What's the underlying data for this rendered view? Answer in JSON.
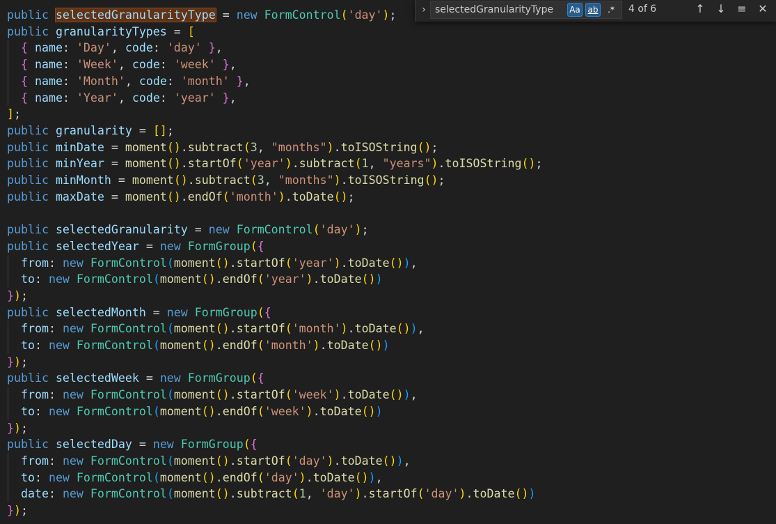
{
  "find": {
    "query": "selectedGranularityType",
    "match_case_label": "Aa",
    "whole_word_label": "ab",
    "regex_label": ".*",
    "match_count": "4 of 6",
    "toggle_replace_icon": "›",
    "prev_icon": "↑",
    "next_icon": "↓",
    "selection_icon": "≡",
    "close_icon": "✕"
  },
  "code_lines": [
    [
      [
        "kw",
        "public "
      ],
      [
        "var",
        "selectedGranularityType",
        "hl"
      ],
      [
        "op",
        " = "
      ],
      [
        "kw",
        "new "
      ],
      [
        "cls",
        "FormControl"
      ],
      [
        "b1",
        "("
      ],
      [
        "str",
        "'day'"
      ],
      [
        "b1",
        ")"
      ],
      [
        "op",
        ";"
      ]
    ],
    [
      [
        "kw",
        "public "
      ],
      [
        "var",
        "granularityTypes"
      ],
      [
        "op",
        " = "
      ],
      [
        "b1",
        "["
      ]
    ],
    [
      [
        "op",
        "  "
      ],
      [
        "b2",
        "{ "
      ],
      [
        "var",
        "name"
      ],
      [
        "op",
        ": "
      ],
      [
        "str",
        "'Day'"
      ],
      [
        "op",
        ", "
      ],
      [
        "var",
        "code"
      ],
      [
        "op",
        ": "
      ],
      [
        "str",
        "'day'"
      ],
      [
        "b2",
        " }"
      ],
      [
        "op",
        ","
      ]
    ],
    [
      [
        "op",
        "  "
      ],
      [
        "b2",
        "{ "
      ],
      [
        "var",
        "name"
      ],
      [
        "op",
        ": "
      ],
      [
        "str",
        "'Week'"
      ],
      [
        "op",
        ", "
      ],
      [
        "var",
        "code"
      ],
      [
        "op",
        ": "
      ],
      [
        "str",
        "'week'"
      ],
      [
        "b2",
        " }"
      ],
      [
        "op",
        ","
      ]
    ],
    [
      [
        "op",
        "  "
      ],
      [
        "b2",
        "{ "
      ],
      [
        "var",
        "name"
      ],
      [
        "op",
        ": "
      ],
      [
        "str",
        "'Month'"
      ],
      [
        "op",
        ", "
      ],
      [
        "var",
        "code"
      ],
      [
        "op",
        ": "
      ],
      [
        "str",
        "'month'"
      ],
      [
        "b2",
        " }"
      ],
      [
        "op",
        ","
      ]
    ],
    [
      [
        "op",
        "  "
      ],
      [
        "b2",
        "{ "
      ],
      [
        "var",
        "name"
      ],
      [
        "op",
        ": "
      ],
      [
        "str",
        "'Year'"
      ],
      [
        "op",
        ", "
      ],
      [
        "var",
        "code"
      ],
      [
        "op",
        ": "
      ],
      [
        "str",
        "'year'"
      ],
      [
        "b2",
        " }"
      ],
      [
        "op",
        ","
      ]
    ],
    [
      [
        "b1",
        "]"
      ],
      [
        "op",
        ";"
      ]
    ],
    [
      [
        "kw",
        "public "
      ],
      [
        "var",
        "granularity"
      ],
      [
        "op",
        " = "
      ],
      [
        "b1",
        "[]"
      ],
      [
        "op",
        ";"
      ]
    ],
    [
      [
        "kw",
        "public "
      ],
      [
        "var",
        "minDate"
      ],
      [
        "op",
        " = "
      ],
      [
        "fn",
        "moment"
      ],
      [
        "b1",
        "()"
      ],
      [
        "op",
        "."
      ],
      [
        "fn",
        "subtract"
      ],
      [
        "b1",
        "("
      ],
      [
        "num",
        "3"
      ],
      [
        "op",
        ", "
      ],
      [
        "str",
        "\"months\""
      ],
      [
        "b1",
        ")"
      ],
      [
        "op",
        "."
      ],
      [
        "fn",
        "toISOString"
      ],
      [
        "b1",
        "()"
      ],
      [
        "op",
        ";"
      ]
    ],
    [
      [
        "kw",
        "public "
      ],
      [
        "var",
        "minYear"
      ],
      [
        "op",
        " = "
      ],
      [
        "fn",
        "moment"
      ],
      [
        "b1",
        "()"
      ],
      [
        "op",
        "."
      ],
      [
        "fn",
        "startOf"
      ],
      [
        "b1",
        "("
      ],
      [
        "str",
        "'year'"
      ],
      [
        "b1",
        ")"
      ],
      [
        "op",
        "."
      ],
      [
        "fn",
        "subtract"
      ],
      [
        "b1",
        "("
      ],
      [
        "num",
        "1"
      ],
      [
        "op",
        ", "
      ],
      [
        "str",
        "\"years\""
      ],
      [
        "b1",
        ")"
      ],
      [
        "op",
        "."
      ],
      [
        "fn",
        "toISOString"
      ],
      [
        "b1",
        "()"
      ],
      [
        "op",
        ";"
      ]
    ],
    [
      [
        "kw",
        "public "
      ],
      [
        "var",
        "minMonth"
      ],
      [
        "op",
        " = "
      ],
      [
        "fn",
        "moment"
      ],
      [
        "b1",
        "()"
      ],
      [
        "op",
        "."
      ],
      [
        "fn",
        "subtract"
      ],
      [
        "b1",
        "("
      ],
      [
        "num",
        "3"
      ],
      [
        "op",
        ", "
      ],
      [
        "str",
        "\"months\""
      ],
      [
        "b1",
        ")"
      ],
      [
        "op",
        "."
      ],
      [
        "fn",
        "toISOString"
      ],
      [
        "b1",
        "()"
      ],
      [
        "op",
        ";"
      ]
    ],
    [
      [
        "kw",
        "public "
      ],
      [
        "var",
        "maxDate"
      ],
      [
        "op",
        " = "
      ],
      [
        "fn",
        "moment"
      ],
      [
        "b1",
        "()"
      ],
      [
        "op",
        "."
      ],
      [
        "fn",
        "endOf"
      ],
      [
        "b1",
        "("
      ],
      [
        "str",
        "'month'"
      ],
      [
        "b1",
        ")"
      ],
      [
        "op",
        "."
      ],
      [
        "fn",
        "toDate"
      ],
      [
        "b1",
        "()"
      ],
      [
        "op",
        ";"
      ]
    ],
    [],
    [
      [
        "kw",
        "public "
      ],
      [
        "var",
        "selectedGranularity"
      ],
      [
        "op",
        " = "
      ],
      [
        "kw",
        "new "
      ],
      [
        "cls",
        "FormControl"
      ],
      [
        "b1",
        "("
      ],
      [
        "str",
        "'day'"
      ],
      [
        "b1",
        ")"
      ],
      [
        "op",
        ";"
      ]
    ],
    [
      [
        "kw",
        "public "
      ],
      [
        "var",
        "selectedYear"
      ],
      [
        "op",
        " = "
      ],
      [
        "kw",
        "new "
      ],
      [
        "cls",
        "FormGroup"
      ],
      [
        "b1",
        "("
      ],
      [
        "b2",
        "{"
      ]
    ],
    [
      [
        "op",
        "  "
      ],
      [
        "var",
        "from"
      ],
      [
        "op",
        ": "
      ],
      [
        "kw",
        "new "
      ],
      [
        "cls",
        "FormControl"
      ],
      [
        "b3",
        "("
      ],
      [
        "fn",
        "moment"
      ],
      [
        "b1",
        "()"
      ],
      [
        "op",
        "."
      ],
      [
        "fn",
        "startOf"
      ],
      [
        "b1",
        "("
      ],
      [
        "str",
        "'year'"
      ],
      [
        "b1",
        ")"
      ],
      [
        "op",
        "."
      ],
      [
        "fn",
        "toDate"
      ],
      [
        "b1",
        "()"
      ],
      [
        "b3",
        ")"
      ],
      [
        "op",
        ","
      ]
    ],
    [
      [
        "op",
        "  "
      ],
      [
        "var",
        "to"
      ],
      [
        "op",
        ": "
      ],
      [
        "kw",
        "new "
      ],
      [
        "cls",
        "FormControl"
      ],
      [
        "b3",
        "("
      ],
      [
        "fn",
        "moment"
      ],
      [
        "b1",
        "()"
      ],
      [
        "op",
        "."
      ],
      [
        "fn",
        "endOf"
      ],
      [
        "b1",
        "("
      ],
      [
        "str",
        "'year'"
      ],
      [
        "b1",
        ")"
      ],
      [
        "op",
        "."
      ],
      [
        "fn",
        "toDate"
      ],
      [
        "b1",
        "()"
      ],
      [
        "b3",
        ")"
      ]
    ],
    [
      [
        "b2",
        "}"
      ],
      [
        "b1",
        ")"
      ],
      [
        "op",
        ";"
      ]
    ],
    [
      [
        "kw",
        "public "
      ],
      [
        "var",
        "selectedMonth"
      ],
      [
        "op",
        " = "
      ],
      [
        "kw",
        "new "
      ],
      [
        "cls",
        "FormGroup"
      ],
      [
        "b1",
        "("
      ],
      [
        "b2",
        "{"
      ]
    ],
    [
      [
        "op",
        "  "
      ],
      [
        "var",
        "from"
      ],
      [
        "op",
        ": "
      ],
      [
        "kw",
        "new "
      ],
      [
        "cls",
        "FormControl"
      ],
      [
        "b3",
        "("
      ],
      [
        "fn",
        "moment"
      ],
      [
        "b1",
        "()"
      ],
      [
        "op",
        "."
      ],
      [
        "fn",
        "startOf"
      ],
      [
        "b1",
        "("
      ],
      [
        "str",
        "'month'"
      ],
      [
        "b1",
        ")"
      ],
      [
        "op",
        "."
      ],
      [
        "fn",
        "toDate"
      ],
      [
        "b1",
        "()"
      ],
      [
        "b3",
        ")"
      ],
      [
        "op",
        ","
      ]
    ],
    [
      [
        "op",
        "  "
      ],
      [
        "var",
        "to"
      ],
      [
        "op",
        ": "
      ],
      [
        "kw",
        "new "
      ],
      [
        "cls",
        "FormControl"
      ],
      [
        "b3",
        "("
      ],
      [
        "fn",
        "moment"
      ],
      [
        "b1",
        "()"
      ],
      [
        "op",
        "."
      ],
      [
        "fn",
        "endOf"
      ],
      [
        "b1",
        "("
      ],
      [
        "str",
        "'month'"
      ],
      [
        "b1",
        ")"
      ],
      [
        "op",
        "."
      ],
      [
        "fn",
        "toDate"
      ],
      [
        "b1",
        "()"
      ],
      [
        "b3",
        ")"
      ]
    ],
    [
      [
        "b2",
        "}"
      ],
      [
        "b1",
        ")"
      ],
      [
        "op",
        ";"
      ]
    ],
    [
      [
        "kw",
        "public "
      ],
      [
        "var",
        "selectedWeek"
      ],
      [
        "op",
        " = "
      ],
      [
        "kw",
        "new "
      ],
      [
        "cls",
        "FormGroup"
      ],
      [
        "b1",
        "("
      ],
      [
        "b2",
        "{"
      ]
    ],
    [
      [
        "op",
        "  "
      ],
      [
        "var",
        "from"
      ],
      [
        "op",
        ": "
      ],
      [
        "kw",
        "new "
      ],
      [
        "cls",
        "FormControl"
      ],
      [
        "b3",
        "("
      ],
      [
        "fn",
        "moment"
      ],
      [
        "b1",
        "()"
      ],
      [
        "op",
        "."
      ],
      [
        "fn",
        "startOf"
      ],
      [
        "b1",
        "("
      ],
      [
        "str",
        "'week'"
      ],
      [
        "b1",
        ")"
      ],
      [
        "op",
        "."
      ],
      [
        "fn",
        "toDate"
      ],
      [
        "b1",
        "()"
      ],
      [
        "b3",
        ")"
      ],
      [
        "op",
        ","
      ]
    ],
    [
      [
        "op",
        "  "
      ],
      [
        "var",
        "to"
      ],
      [
        "op",
        ": "
      ],
      [
        "kw",
        "new "
      ],
      [
        "cls",
        "FormControl"
      ],
      [
        "b3",
        "("
      ],
      [
        "fn",
        "moment"
      ],
      [
        "b1",
        "()"
      ],
      [
        "op",
        "."
      ],
      [
        "fn",
        "endOf"
      ],
      [
        "b1",
        "("
      ],
      [
        "str",
        "'week'"
      ],
      [
        "b1",
        ")"
      ],
      [
        "op",
        "."
      ],
      [
        "fn",
        "toDate"
      ],
      [
        "b1",
        "()"
      ],
      [
        "b3",
        ")"
      ]
    ],
    [
      [
        "b2",
        "}"
      ],
      [
        "b1",
        ")"
      ],
      [
        "op",
        ";"
      ]
    ],
    [
      [
        "kw",
        "public "
      ],
      [
        "var",
        "selectedDay"
      ],
      [
        "op",
        " = "
      ],
      [
        "kw",
        "new "
      ],
      [
        "cls",
        "FormGroup"
      ],
      [
        "b1",
        "("
      ],
      [
        "b2",
        "{"
      ]
    ],
    [
      [
        "op",
        "  "
      ],
      [
        "var",
        "from"
      ],
      [
        "op",
        ": "
      ],
      [
        "kw",
        "new "
      ],
      [
        "cls",
        "FormControl"
      ],
      [
        "b3",
        "("
      ],
      [
        "fn",
        "moment"
      ],
      [
        "b1",
        "()"
      ],
      [
        "op",
        "."
      ],
      [
        "fn",
        "startOf"
      ],
      [
        "b1",
        "("
      ],
      [
        "str",
        "'day'"
      ],
      [
        "b1",
        ")"
      ],
      [
        "op",
        "."
      ],
      [
        "fn",
        "toDate"
      ],
      [
        "b1",
        "()"
      ],
      [
        "b3",
        ")"
      ],
      [
        "op",
        ","
      ]
    ],
    [
      [
        "op",
        "  "
      ],
      [
        "var",
        "to"
      ],
      [
        "op",
        ": "
      ],
      [
        "kw",
        "new "
      ],
      [
        "cls",
        "FormControl"
      ],
      [
        "b3",
        "("
      ],
      [
        "fn",
        "moment"
      ],
      [
        "b1",
        "()"
      ],
      [
        "op",
        "."
      ],
      [
        "fn",
        "endOf"
      ],
      [
        "b1",
        "("
      ],
      [
        "str",
        "'day'"
      ],
      [
        "b1",
        ")"
      ],
      [
        "op",
        "."
      ],
      [
        "fn",
        "toDate"
      ],
      [
        "b1",
        "()"
      ],
      [
        "b3",
        ")"
      ],
      [
        "op",
        ","
      ]
    ],
    [
      [
        "op",
        "  "
      ],
      [
        "var",
        "date"
      ],
      [
        "op",
        ": "
      ],
      [
        "kw",
        "new "
      ],
      [
        "cls",
        "FormControl"
      ],
      [
        "b3",
        "("
      ],
      [
        "fn",
        "moment"
      ],
      [
        "b1",
        "()"
      ],
      [
        "op",
        "."
      ],
      [
        "fn",
        "subtract"
      ],
      [
        "b1",
        "("
      ],
      [
        "num",
        "1"
      ],
      [
        "op",
        ", "
      ],
      [
        "str",
        "'day'"
      ],
      [
        "b1",
        ")"
      ],
      [
        "op",
        "."
      ],
      [
        "fn",
        "startOf"
      ],
      [
        "b1",
        "("
      ],
      [
        "str",
        "'day'"
      ],
      [
        "b1",
        ")"
      ],
      [
        "op",
        "."
      ],
      [
        "fn",
        "toDate"
      ],
      [
        "b1",
        "()"
      ],
      [
        "b3",
        ")"
      ]
    ],
    [
      [
        "b2",
        "}"
      ],
      [
        "b1",
        ")"
      ],
      [
        "op",
        ";"
      ]
    ]
  ]
}
